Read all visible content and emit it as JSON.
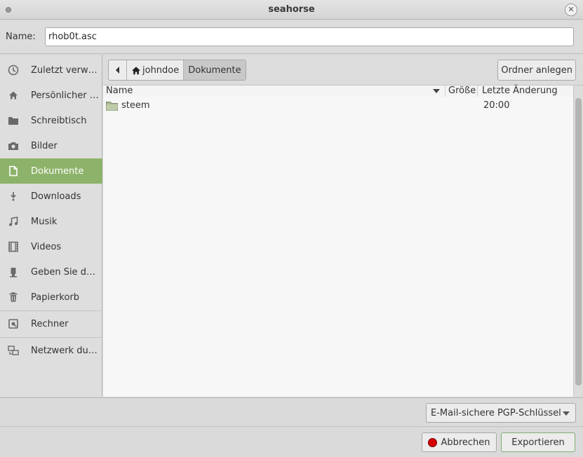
{
  "window": {
    "title": "seahorse",
    "close_symbol": "✕"
  },
  "name_field": {
    "label": "Name:",
    "value": "rhob0t.asc"
  },
  "sidebar": {
    "items": [
      {
        "label": "Zuletzt verw…",
        "icon": "clock-icon"
      },
      {
        "label": "Persönlicher …",
        "icon": "home-icon"
      },
      {
        "label": "Schreibtisch",
        "icon": "folder-icon"
      },
      {
        "label": "Bilder",
        "icon": "camera-icon"
      },
      {
        "label": "Dokumente",
        "icon": "document-icon",
        "active": true
      },
      {
        "label": "Downloads",
        "icon": "download-icon"
      },
      {
        "label": "Musik",
        "icon": "music-icon"
      },
      {
        "label": "Videos",
        "icon": "film-icon"
      },
      {
        "label": "Geben Sie d…",
        "icon": "usb-icon"
      },
      {
        "label": "Papierkorb",
        "icon": "trash-icon"
      },
      {
        "label": "Rechner",
        "icon": "drive-icon"
      },
      {
        "label": "Netzwerk du…",
        "icon": "network-icon"
      }
    ]
  },
  "pathbar": {
    "segments": [
      "johndoe",
      "Dokumente"
    ]
  },
  "toolbar": {
    "new_folder_label": "Ordner anlegen"
  },
  "filelist": {
    "columns": {
      "name": "Name",
      "size": "Größe",
      "modified": "Letzte Änderung"
    },
    "rows": [
      {
        "name": "steem",
        "size": "",
        "modified": "20:00"
      }
    ]
  },
  "filter": {
    "selected": "E-Mail-sichere PGP-Schlüssel"
  },
  "actions": {
    "cancel_label": "Abbrechen",
    "export_label": "Exportieren"
  },
  "colors": {
    "accent": "#8db26a",
    "stop": "#d40000"
  }
}
